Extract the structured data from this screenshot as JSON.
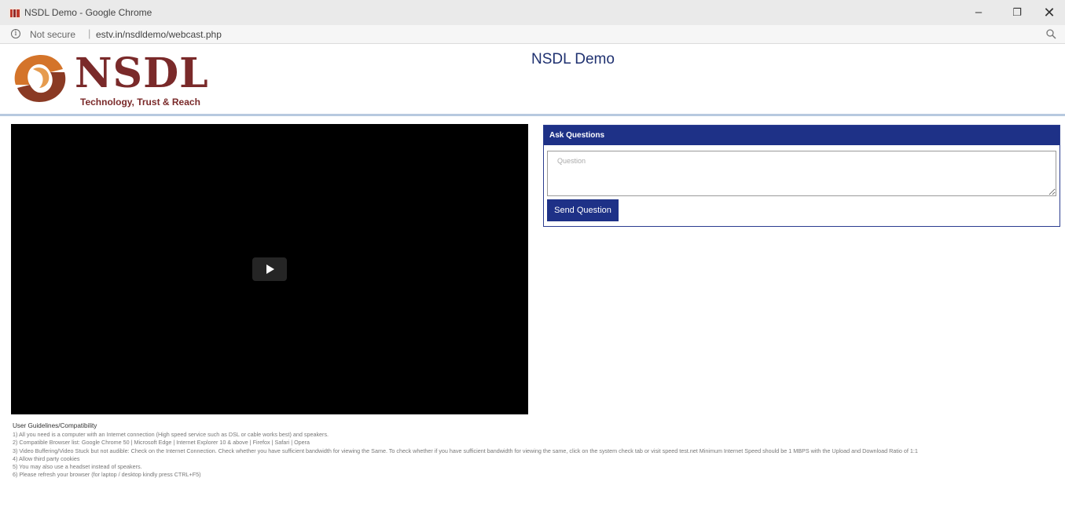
{
  "window": {
    "title": "NSDL Demo - Google Chrome",
    "minimize_icon": "minimize-icon",
    "maximize_icon": "restore-icon",
    "close_icon": "close-icon"
  },
  "address_bar": {
    "security_label": "Not secure",
    "url": "estv.in/nsdldemo/webcast.php",
    "info_icon": "info-icon",
    "zoom_icon": "zoom-icon"
  },
  "header": {
    "logo_text": "NSDL",
    "logo_tagline": "Technology, Trust & Reach",
    "title": "NSDL Demo"
  },
  "video": {
    "play_icon": "play-icon"
  },
  "questions": {
    "header": "Ask Questions",
    "placeholder": "Question",
    "value": "",
    "send_label": "Send Question"
  },
  "guidelines": {
    "title": "User Guidelines/Compatibility",
    "items": [
      "1) All you need is a computer with an Internet connection (High speed service such as DSL or cable works best) and speakers.",
      "2) Compatible Browser list: Google Chrome 50 | Microsoft Edge | Internet Explorer 10 & above | Firefox | Safari | Opera",
      "3) Video Buffering/Video Stuck but not audible: Check on the Internet Connection. Check whether you have sufficient bandwidth for viewing the Same. To check whether if you have sufficient bandwidth for viewing the same, click on the system check tab or visit speed test.net Minimum Internet Speed should be 1 MBPS with the Upload and Download Ratio of 1:1",
      "4) Allow third party cookies",
      "5) You may also use a headset instead of speakers.",
      "6) Please refresh your browser (for laptop / desktop kindly press CTRL+F5)"
    ]
  },
  "colors": {
    "brand_navy": "#1e3187",
    "brand_maroon": "#7a2a2a",
    "logo_orange": "#d4742a"
  }
}
